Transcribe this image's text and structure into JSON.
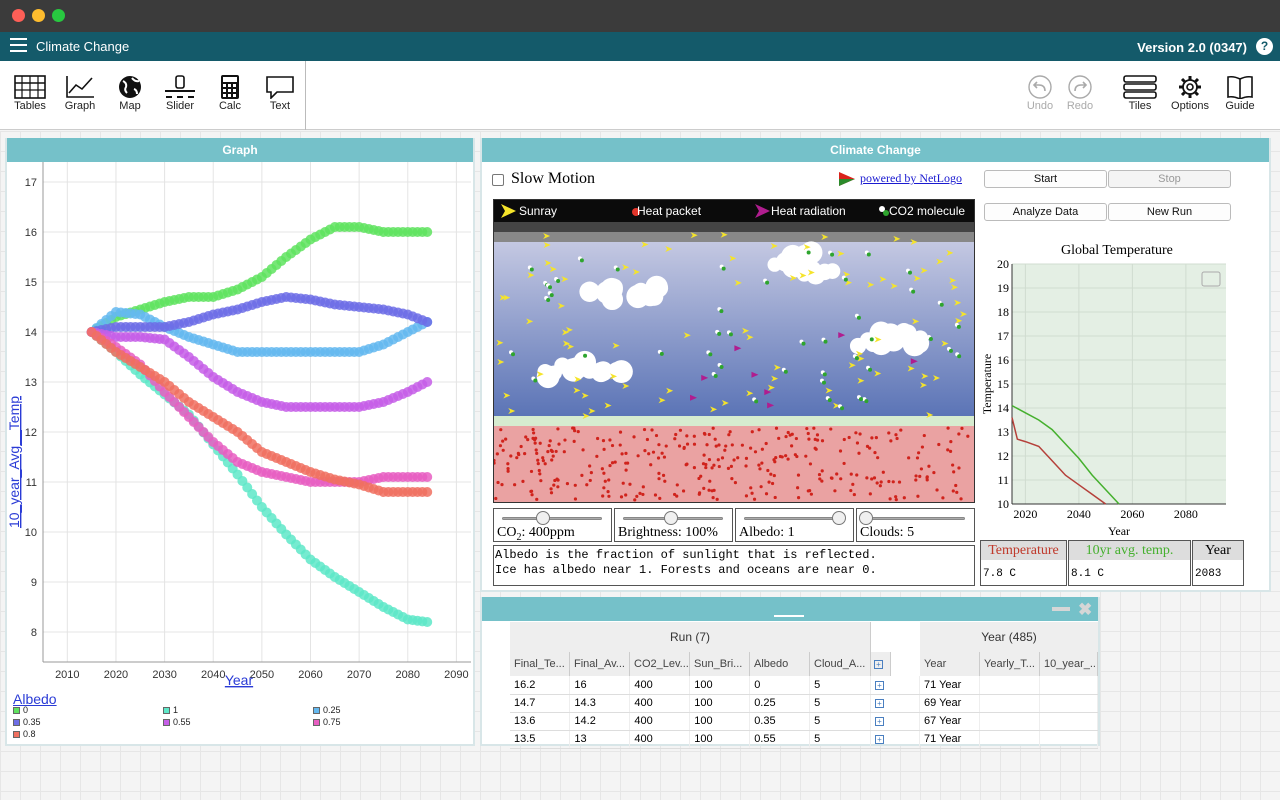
{
  "app": {
    "title": "Climate Change",
    "version": "Version 2.0 (0347)",
    "help": "?"
  },
  "toolbar": {
    "left": [
      {
        "name": "tables",
        "label": "Tables",
        "icon": "table-icon"
      },
      {
        "name": "graph",
        "label": "Graph",
        "icon": "graph-icon"
      },
      {
        "name": "map",
        "label": "Map",
        "icon": "globe-icon"
      },
      {
        "name": "slider",
        "label": "Slider",
        "icon": "slider-icon"
      },
      {
        "name": "calc",
        "label": "Calc",
        "icon": "calculator-icon"
      },
      {
        "name": "text",
        "label": "Text",
        "icon": "text-icon"
      }
    ],
    "right": [
      {
        "name": "undo",
        "label": "Undo",
        "icon": "undo-icon",
        "disabled": true
      },
      {
        "name": "redo",
        "label": "Redo",
        "icon": "redo-icon",
        "disabled": true
      },
      {
        "name": "tiles",
        "label": "Tiles",
        "icon": "tiles-icon"
      },
      {
        "name": "options",
        "label": "Options",
        "icon": "gear-icon"
      },
      {
        "name": "guide",
        "label": "Guide",
        "icon": "book-icon"
      }
    ]
  },
  "graph_tile": {
    "title": "Graph",
    "legend_title": "Albedo",
    "legend": [
      {
        "label": "0",
        "color": "#5fe35f"
      },
      {
        "label": "1",
        "color": "#5ee8c8"
      },
      {
        "label": "0.25",
        "color": "#64b9f0"
      },
      {
        "label": "0.35",
        "color": "#6d6de6"
      },
      {
        "label": "0.55",
        "color": "#c65ee8"
      },
      {
        "label": "0.75",
        "color": "#e85ec2"
      },
      {
        "label": "0.8",
        "color": "#f07060"
      }
    ]
  },
  "chart_data": [
    {
      "type": "scatter",
      "title": "",
      "xlabel": "Year",
      "ylabel": "10_year_Avg__Temp",
      "xlim": [
        2005,
        2093
      ],
      "ylim": [
        7.4,
        17.4
      ],
      "xticks": [
        2010,
        2020,
        2030,
        2040,
        2050,
        2060,
        2070,
        2080,
        2090
      ],
      "yticks": [
        8,
        9,
        10,
        11,
        12,
        13,
        14,
        15,
        16,
        17
      ],
      "series": [
        {
          "name": "0",
          "color": "#5fe35f",
          "points": [
            [
              2015,
              14
            ],
            [
              2020,
              14.3
            ],
            [
              2025,
              14.45
            ],
            [
              2030,
              14.6
            ],
            [
              2035,
              14.7
            ],
            [
              2040,
              14.7
            ],
            [
              2045,
              14.85
            ],
            [
              2050,
              15.1
            ],
            [
              2055,
              15.5
            ],
            [
              2060,
              15.85
            ],
            [
              2065,
              16.1
            ],
            [
              2070,
              16.1
            ],
            [
              2075,
              16
            ],
            [
              2080,
              16
            ],
            [
              2084,
              16
            ]
          ]
        },
        {
          "name": "1",
          "color": "#5ee8c8",
          "points": [
            [
              2015,
              14
            ],
            [
              2020,
              13.6
            ],
            [
              2025,
              13.15
            ],
            [
              2030,
              12.75
            ],
            [
              2035,
              12.35
            ],
            [
              2040,
              11.75
            ],
            [
              2045,
              11.15
            ],
            [
              2050,
              10.5
            ],
            [
              2055,
              9.95
            ],
            [
              2060,
              9.45
            ],
            [
              2065,
              9.1
            ],
            [
              2070,
              8.8
            ],
            [
              2075,
              8.5
            ],
            [
              2080,
              8.25
            ],
            [
              2084,
              8.2
            ]
          ]
        },
        {
          "name": "0.25",
          "color": "#64b9f0",
          "points": [
            [
              2015,
              14
            ],
            [
              2020,
              14.4
            ],
            [
              2025,
              14.35
            ],
            [
              2030,
              14.1
            ],
            [
              2035,
              13.9
            ],
            [
              2040,
              13.75
            ],
            [
              2045,
              13.6
            ],
            [
              2050,
              13.6
            ],
            [
              2055,
              13.6
            ],
            [
              2060,
              13.6
            ],
            [
              2065,
              13.6
            ],
            [
              2070,
              13.6
            ],
            [
              2075,
              13.75
            ],
            [
              2080,
              14
            ],
            [
              2084,
              14.2
            ]
          ]
        },
        {
          "name": "0.35",
          "color": "#6d6de6",
          "points": [
            [
              2015,
              14
            ],
            [
              2020,
              14.1
            ],
            [
              2025,
              14.1
            ],
            [
              2030,
              14.1
            ],
            [
              2035,
              14.2
            ],
            [
              2040,
              14.35
            ],
            [
              2045,
              14.45
            ],
            [
              2050,
              14.6
            ],
            [
              2055,
              14.7
            ],
            [
              2060,
              14.65
            ],
            [
              2065,
              14.55
            ],
            [
              2070,
              14.5
            ],
            [
              2075,
              14.45
            ],
            [
              2080,
              14.35
            ],
            [
              2084,
              14.2
            ]
          ]
        },
        {
          "name": "0.55",
          "color": "#c65ee8",
          "points": [
            [
              2015,
              14
            ],
            [
              2020,
              13.9
            ],
            [
              2025,
              13.9
            ],
            [
              2030,
              13.85
            ],
            [
              2035,
              13.5
            ],
            [
              2040,
              13.1
            ],
            [
              2045,
              12.8
            ],
            [
              2050,
              12.6
            ],
            [
              2055,
              12.5
            ],
            [
              2060,
              12.5
            ],
            [
              2065,
              12.5
            ],
            [
              2070,
              12.5
            ],
            [
              2075,
              12.6
            ],
            [
              2080,
              12.8
            ],
            [
              2084,
              13
            ]
          ]
        },
        {
          "name": "0.75",
          "color": "#e85ec2",
          "points": [
            [
              2015,
              14
            ],
            [
              2020,
              13.7
            ],
            [
              2025,
              13.35
            ],
            [
              2030,
              12.8
            ],
            [
              2035,
              12.3
            ],
            [
              2040,
              11.8
            ],
            [
              2045,
              11.4
            ],
            [
              2050,
              11.2
            ],
            [
              2055,
              11.1
            ],
            [
              2060,
              11
            ],
            [
              2065,
              11
            ],
            [
              2070,
              11
            ],
            [
              2075,
              11.1
            ],
            [
              2080,
              11.1
            ],
            [
              2084,
              11.1
            ]
          ]
        },
        {
          "name": "0.8",
          "color": "#f07060",
          "points": [
            [
              2015,
              14
            ],
            [
              2020,
              13.6
            ],
            [
              2025,
              13.3
            ],
            [
              2030,
              13
            ],
            [
              2035,
              12.6
            ],
            [
              2040,
              12.3
            ],
            [
              2045,
              12
            ],
            [
              2050,
              11.6
            ],
            [
              2055,
              11.4
            ],
            [
              2060,
              11.2
            ],
            [
              2065,
              11.05
            ],
            [
              2070,
              10.95
            ],
            [
              2075,
              10.8
            ],
            [
              2080,
              10.8
            ],
            [
              2084,
              10.8
            ]
          ]
        }
      ]
    },
    {
      "type": "line",
      "title": "Global Temperature",
      "xlabel": "Year",
      "ylabel": "Temperature",
      "xlim": [
        2015,
        2095
      ],
      "ylim": [
        10,
        20
      ],
      "xticks": [
        2020,
        2040,
        2060,
        2080
      ],
      "yticks": [
        10,
        11,
        12,
        13,
        14,
        15,
        16,
        17,
        18,
        19,
        20
      ],
      "series": [
        {
          "name": "Temperature",
          "color": "#b5403a",
          "points": [
            [
              2015,
              13.6
            ],
            [
              2017,
              12.7
            ],
            [
              2020,
              12.6
            ],
            [
              2025,
              12.4
            ],
            [
              2030,
              11.8
            ],
            [
              2035,
              11.2
            ],
            [
              2040,
              10.8
            ],
            [
              2045,
              10.4
            ],
            [
              2050,
              10
            ]
          ]
        },
        {
          "name": "10yr avg. temp.",
          "color": "#45b02e",
          "points": [
            [
              2015,
              14.1
            ],
            [
              2020,
              13.8
            ],
            [
              2025,
              13.5
            ],
            [
              2030,
              13.1
            ],
            [
              2035,
              12.5
            ],
            [
              2040,
              11.9
            ],
            [
              2045,
              11.2
            ],
            [
              2050,
              10.6
            ],
            [
              2055,
              10
            ]
          ]
        }
      ]
    }
  ],
  "netlogo": {
    "title": "Climate Change",
    "slow_motion": "Slow Motion",
    "powered": "powered by NetLogo",
    "buttons": {
      "start": "Start",
      "stop": "Stop",
      "analyze": "Analyze Data",
      "new_run": "New Run"
    },
    "legend": [
      "Sunray",
      "Heat packet",
      "Heat radiation",
      "CO2 molecule"
    ],
    "colors": {
      "sky_top": "#c4c8e2",
      "sky_bottom": "#5b74b6",
      "earth": "#eaa2a2",
      "ground_line": "#d6ebcf"
    },
    "sliders": [
      {
        "label_pre": "CO",
        "label_sub": "2",
        "label_post": ": 400ppm",
        "value": 0.43
      },
      {
        "label": "Brightness: 100%",
        "value": 0.5
      },
      {
        "label": "Albedo: 1",
        "value": 1
      },
      {
        "label": "Clouds: 5",
        "value": 0.0
      }
    ],
    "note": [
      "Albedo is the fraction of sunlight that is reflected.",
      "Ice has albedo near 1. Forests and oceans are near 0."
    ],
    "monitors": [
      {
        "label": "Temperature",
        "value": "7.8 C",
        "color": "#c0392b"
      },
      {
        "label": "10yr avg. temp.",
        "value": "8.1 C",
        "color": "#45b02e"
      },
      {
        "label": "Year",
        "value": "2083",
        "color": "#111111"
      }
    ]
  },
  "table_tile": {
    "run_header": "Run (7)",
    "year_header": "Year (485)",
    "run_columns": [
      "Final_Te...",
      "Final_Av...",
      "CO2_Lev...",
      "Sun_Bri...",
      "Albedo",
      "Cloud_A..."
    ],
    "year_columns": [
      "Year",
      "Yearly_T...",
      "10_year_..."
    ],
    "rows": [
      {
        "cells": [
          "16.2",
          "16",
          "400",
          "100",
          "0",
          "5"
        ],
        "year": "71 Year"
      },
      {
        "cells": [
          "14.7",
          "14.3",
          "400",
          "100",
          "0.25",
          "5"
        ],
        "year": "69 Year"
      },
      {
        "cells": [
          "13.6",
          "14.2",
          "400",
          "100",
          "0.35",
          "5"
        ],
        "year": "67 Year"
      },
      {
        "cells": [
          "13.5",
          "13",
          "400",
          "100",
          "0.55",
          "5"
        ],
        "year": "71 Year"
      }
    ]
  }
}
